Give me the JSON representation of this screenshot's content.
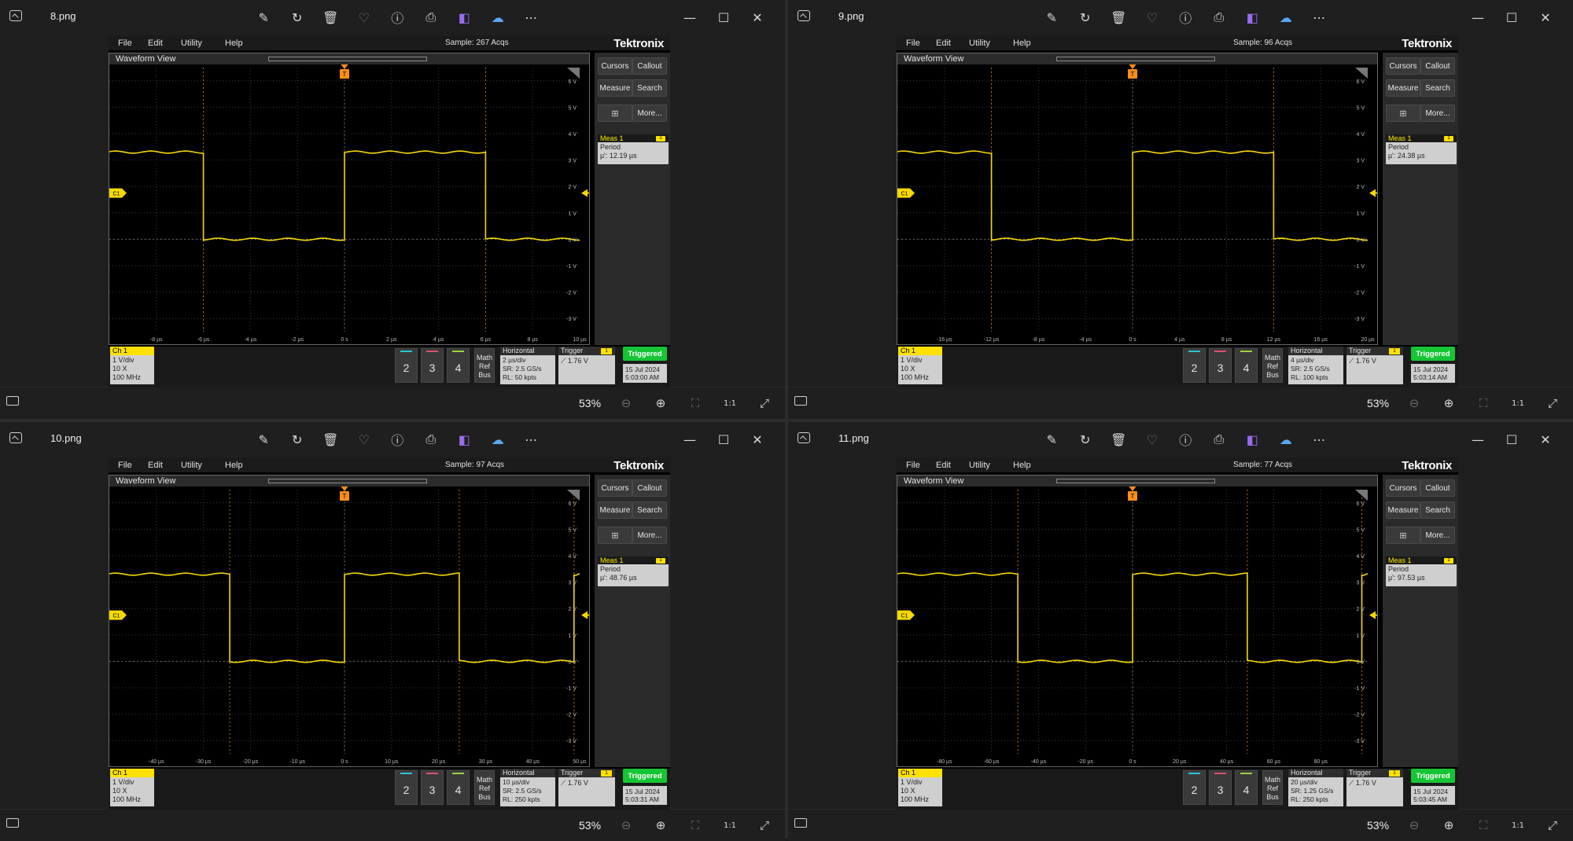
{
  "toolbar_icons": [
    "edit-icon",
    "rotate-icon",
    "delete-icon",
    "favorite-icon",
    "info-icon",
    "print-icon",
    "visual-search-icon",
    "onedrive-icon",
    "more-icon"
  ],
  "panes": [
    {
      "filename": "8.png",
      "zoom": "53%",
      "scope": {
        "menu": [
          "File",
          "Edit",
          "Utility",
          "Help"
        ],
        "sample": "Sample: 267 Acqs",
        "brand": "Tektronix",
        "waveform_title": "Waveform View",
        "x_ticks": [
          "-8 µs",
          "-6 µs",
          "-4 µs",
          "-2 µs",
          "0 s",
          "2 µs",
          "4 µs",
          "6 µs",
          "8 µs",
          "10 µs"
        ],
        "y_ticks": [
          "6 V",
          "5 V",
          "4 V",
          "3 V",
          "2 V",
          "1 V",
          "0 V",
          "-1 V",
          "-2 V",
          "-3 V"
        ],
        "buttons": [
          "Cursors",
          "Callout",
          "Measure",
          "Search",
          "More..."
        ],
        "meas": {
          "title": "Meas 1",
          "badge": "1",
          "label": "Period",
          "value": "µ': 12.19 µs"
        },
        "ch1": {
          "title": "Ch 1",
          "lines": [
            "1 V/div",
            "10 X",
            "100 MHz"
          ]
        },
        "channels": [
          "2",
          "3",
          "4"
        ],
        "math": [
          "Math",
          "Ref",
          "Bus"
        ],
        "horizontal": {
          "title": "Horizontal",
          "lines": [
            "2 µs/div",
            "SR: 2.5 GS/s",
            "RL: 50 kpts"
          ]
        },
        "trigger": {
          "title": "Trigger",
          "badge": "1",
          "value": "1.76 V"
        },
        "status": "Triggered",
        "date": "15 Jul 2024",
        "time": "5:03:00 AM",
        "trigger_marker": "T",
        "ch_marker": "C1",
        "wave": {
          "high_v": 3.3,
          "low_v": 0.0,
          "edges_us": [
            -6,
            0,
            6
          ],
          "start_level": "high",
          "x_min_us": -10,
          "x_max_us": 10
        }
      }
    },
    {
      "filename": "9.png",
      "zoom": "53%",
      "scope": {
        "menu": [
          "File",
          "Edit",
          "Utility",
          "Help"
        ],
        "sample": "Sample: 96 Acqs",
        "brand": "Tektronix",
        "waveform_title": "Waveform View",
        "x_ticks": [
          "-16 µs",
          "-12 µs",
          "-8 µs",
          "-4 µs",
          "0 s",
          "4 µs",
          "8 µs",
          "12 µs",
          "16 µs",
          "20 µs"
        ],
        "y_ticks": [
          "6 V",
          "5 V",
          "4 V",
          "3 V",
          "2 V",
          "1 V",
          "0 V",
          "-1 V",
          "-2 V",
          "-3 V"
        ],
        "buttons": [
          "Cursors",
          "Callout",
          "Measure",
          "Search",
          "More..."
        ],
        "meas": {
          "title": "Meas 1",
          "badge": "1",
          "label": "Period",
          "value": "µ': 24.38 µs"
        },
        "ch1": {
          "title": "Ch 1",
          "lines": [
            "1 V/div",
            "10 X",
            "100 MHz"
          ]
        },
        "channels": [
          "2",
          "3",
          "4"
        ],
        "math": [
          "Math",
          "Ref",
          "Bus"
        ],
        "horizontal": {
          "title": "Horizontal",
          "lines": [
            "4 µs/div",
            "SR: 2.5 GS/s",
            "RL: 100 kpts"
          ]
        },
        "trigger": {
          "title": "Trigger",
          "badge": "1",
          "value": "1.76 V"
        },
        "status": "Triggered",
        "date": "15 Jul 2024",
        "time": "5:03:14 AM",
        "trigger_marker": "T",
        "ch_marker": "C1",
        "wave": {
          "high_v": 3.3,
          "low_v": 0.0,
          "edges_us": [
            -12,
            0,
            12
          ],
          "start_level": "high",
          "x_min_us": -20,
          "x_max_us": 20
        }
      }
    },
    {
      "filename": "10.png",
      "zoom": "53%",
      "scope": {
        "menu": [
          "File",
          "Edit",
          "Utility",
          "Help"
        ],
        "sample": "Sample: 97 Acqs",
        "brand": "Tektronix",
        "waveform_title": "Waveform View",
        "x_ticks": [
          "-40 µs",
          "-30 µs",
          "-20 µs",
          "-10 µs",
          "0 s",
          "10 µs",
          "20 µs",
          "30 µs",
          "40 µs",
          "50 µs"
        ],
        "y_ticks": [
          "6 V",
          "5 V",
          "4 V",
          "3 V",
          "2 V",
          "1 V",
          "0 V",
          "-1 V",
          "-2 V",
          "-3 V"
        ],
        "buttons": [
          "Cursors",
          "Callout",
          "Measure",
          "Search",
          "More..."
        ],
        "meas": {
          "title": "Meas 1",
          "badge": "1",
          "label": "Period",
          "value": "µ': 48.76 µs"
        },
        "ch1": {
          "title": "Ch 1",
          "lines": [
            "1 V/div",
            "10 X",
            "100 MHz"
          ]
        },
        "channels": [
          "2",
          "3",
          "4"
        ],
        "math": [
          "Math",
          "Ref",
          "Bus"
        ],
        "horizontal": {
          "title": "Horizontal",
          "lines": [
            "10 µs/div",
            "SR: 2.5 GS/s",
            "RL: 250 kpts"
          ]
        },
        "trigger": {
          "title": "Trigger",
          "badge": "1",
          "value": "1.76 V"
        },
        "status": "Triggered",
        "date": "15 Jul 2024",
        "time": "5:03:31 AM",
        "trigger_marker": "T",
        "ch_marker": "C1",
        "wave": {
          "high_v": 3.3,
          "low_v": 0.0,
          "edges_us": [
            -24.4,
            0,
            24.4,
            48.8
          ],
          "start_level": "high",
          "x_min_us": -50,
          "x_max_us": 50
        }
      }
    },
    {
      "filename": "11.png",
      "zoom": "53%",
      "scope": {
        "menu": [
          "File",
          "Edit",
          "Utility",
          "Help"
        ],
        "sample": "Sample: 77 Acqs",
        "brand": "Tektronix",
        "waveform_title": "Waveform View",
        "x_ticks": [
          "-80 µs",
          "-60 µs",
          "-40 µs",
          "-20 µs",
          "0 s",
          "20 µs",
          "40 µs",
          "60 µs",
          "80 µs"
        ],
        "y_ticks": [
          "6 V",
          "5 V",
          "4 V",
          "3 V",
          "2 V",
          "1 V",
          "0 V",
          "-1 V",
          "-2 V",
          "-3 V"
        ],
        "buttons": [
          "Cursors",
          "Callout",
          "Measure",
          "Search",
          "More..."
        ],
        "meas": {
          "title": "Meas 1",
          "badge": "1",
          "label": "Period",
          "value": "µ': 97.53 µs"
        },
        "ch1": {
          "title": "Ch 1",
          "lines": [
            "1 V/div",
            "10 X",
            "100 MHz"
          ]
        },
        "channels": [
          "2",
          "3",
          "4"
        ],
        "math": [
          "Math",
          "Ref",
          "Bus"
        ],
        "horizontal": {
          "title": "Horizontal",
          "lines": [
            "20 µs/div",
            "SR: 1.25 GS/s",
            "RL: 250 kpts"
          ]
        },
        "trigger": {
          "title": "Trigger",
          "badge": "1",
          "value": "1.76 V"
        },
        "status": "Triggered",
        "date": "15 Jul 2024",
        "time": "5:03:45 AM",
        "trigger_marker": "T",
        "ch_marker": "C1",
        "wave": {
          "high_v": 3.3,
          "low_v": 0.0,
          "edges_us": [
            -48.8,
            0,
            48.8,
            97.5
          ],
          "start_level": "high",
          "x_min_us": -100,
          "x_max_us": 100
        }
      }
    }
  ],
  "colors": {
    "trace": "#f5d800",
    "grid": "#3a3a3a",
    "ch2": "#29c6d6",
    "ch3": "#e0506e",
    "ch4": "#9ad43a",
    "triggered": "#16c534",
    "trigger_marker": "#ff8c1a"
  }
}
